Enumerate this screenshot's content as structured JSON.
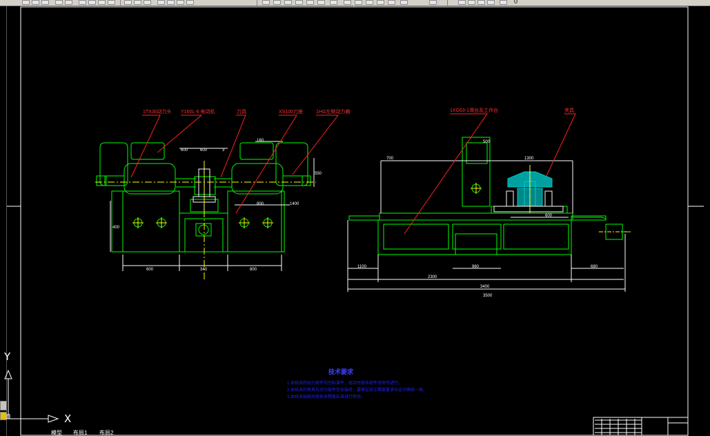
{
  "toolbar": {
    "layer_name": "0",
    "colors": {
      "face": "#d4d0c8",
      "shadow": "#808080"
    }
  },
  "ucs": {
    "y_label": "Y",
    "x_label": "X"
  },
  "layout_tabs": [
    {
      "label": "模型"
    },
    {
      "label": "布局1"
    },
    {
      "label": "布局2"
    }
  ],
  "drawing": {
    "background": "#000000",
    "colors": {
      "outline": "#00ff00",
      "dimension": "#ffffff",
      "leader": "#ff0000",
      "labels": "#ff3030",
      "fixture": "#00c8c8",
      "notes": "#2020ff",
      "centerline": "#ffff00",
      "frame": "#ffffff"
    },
    "left_view": {
      "leader_labels": [
        "1TX30动力头",
        "Y160L-6 电动机",
        "刀具",
        "XS100刀座",
        "1HG左侧动力箱"
      ],
      "dims": [
        "600",
        "340",
        "800",
        "600",
        "160",
        "400",
        "550",
        "600",
        "800",
        "3",
        "1400"
      ]
    },
    "right_view": {
      "leader_labels": [
        "1XG63-1滑台及工作台",
        "夹具"
      ],
      "dims": [
        "3400",
        "1100",
        "960",
        "680",
        "1300",
        "700",
        "600",
        "500",
        "2300",
        "3500"
      ]
    },
    "notes": {
      "title": "技术要求",
      "lines": [
        "1.本机床的动力部件均为标准件，组合时按各部件说明书进行。",
        "2.本机床的夹具与动力部件在安装时，要保证加工精度要求与设计图纸一致。",
        "3.本机床装配后按机床精度标准进行检验。"
      ]
    }
  }
}
